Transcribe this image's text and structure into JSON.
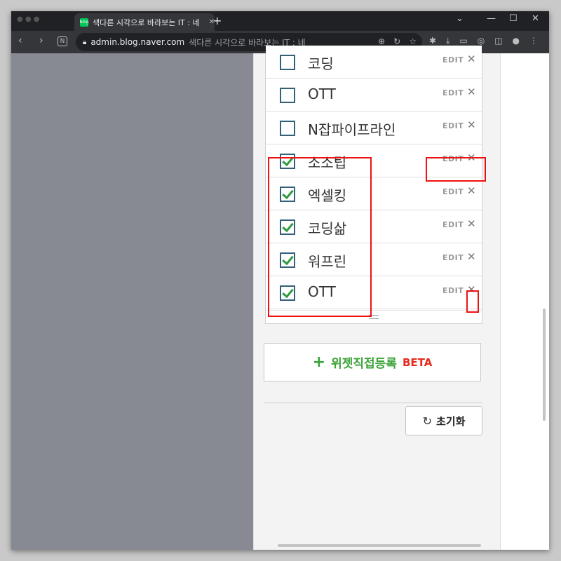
{
  "browser": {
    "tab_title": "색다른 시각으로 바라보는 IT : 네",
    "new_tab": "+",
    "url_host": "admin.blog.naver.com",
    "url_rest": "색다른 시각으로 바라보는 IT : 네",
    "favicon_text": "blog"
  },
  "list": {
    "edit_label": "EDIT",
    "close_glyph": "✕",
    "rows": [
      {
        "label": "코딩",
        "checked": false
      },
      {
        "label": "OTT",
        "checked": false
      },
      {
        "label": "N잡파이프라인",
        "checked": false
      },
      {
        "label": "소소팁",
        "checked": true
      },
      {
        "label": "엑셀킹",
        "checked": true
      },
      {
        "label": "코딩삶",
        "checked": true
      },
      {
        "label": "워프린",
        "checked": true
      },
      {
        "label": "OTT",
        "checked": true
      }
    ]
  },
  "widget_button": {
    "plus": "+",
    "label": "위젯직접등록",
    "badge": "BETA"
  },
  "reset_button": {
    "icon": "↻",
    "label": "초기화"
  },
  "colors": {
    "accent_green": "#3aa236",
    "beta_red": "#e62b1e",
    "highlight_red": "#e11111"
  }
}
